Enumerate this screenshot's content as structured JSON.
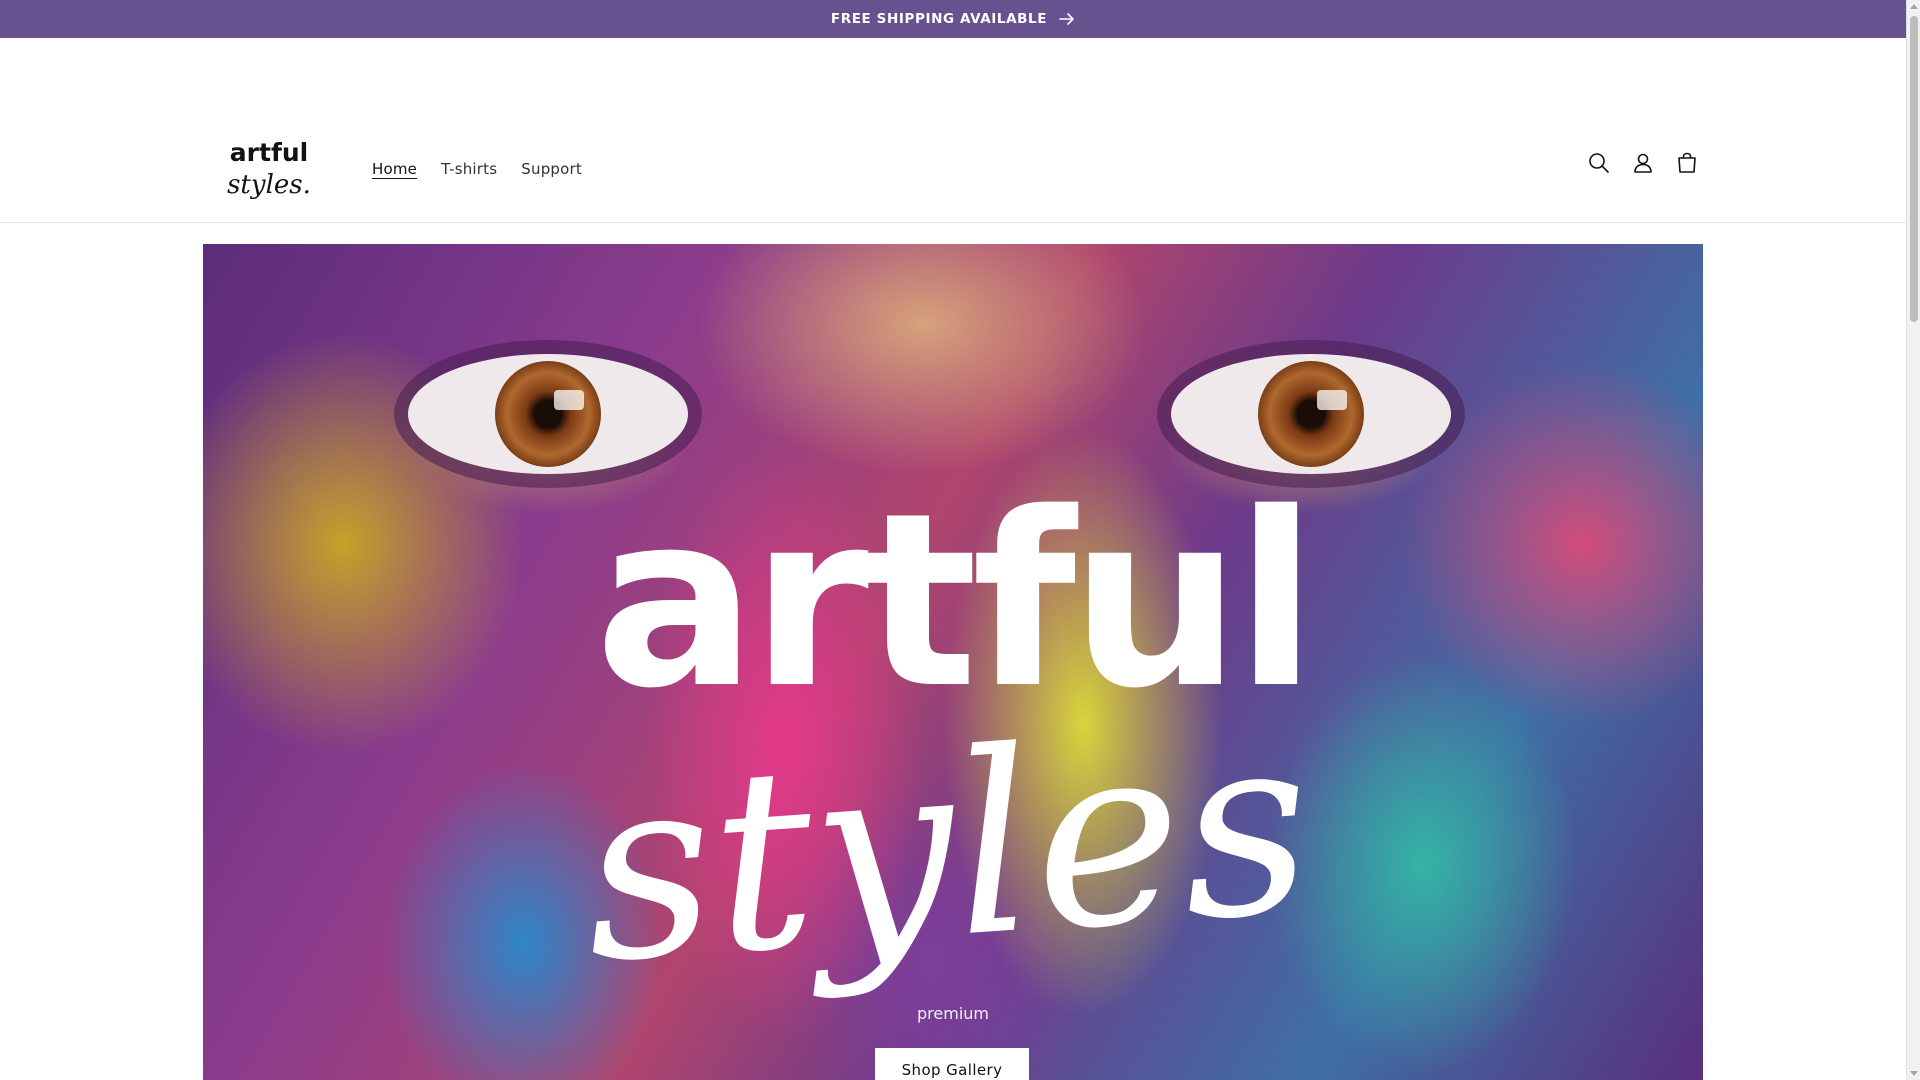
{
  "announcement": {
    "text": "FREE SHIPPING AVAILABLE",
    "icon": "arrow-right-icon"
  },
  "header": {
    "logo": {
      "line1": "artful",
      "line2": "styles."
    },
    "nav": [
      {
        "label": "Home",
        "active": true
      },
      {
        "label": "T-shirts",
        "active": false
      },
      {
        "label": "Support",
        "active": false
      }
    ],
    "icons": [
      "search-icon",
      "account-icon",
      "cart-icon"
    ]
  },
  "hero": {
    "logo_line1": "artful",
    "logo_line2": "styles",
    "subheading": "premium",
    "button_label": "Shop Gallery"
  },
  "colors": {
    "announcement_bg": "#67518f",
    "text": "#121212",
    "button_bg": "#ffffff"
  }
}
